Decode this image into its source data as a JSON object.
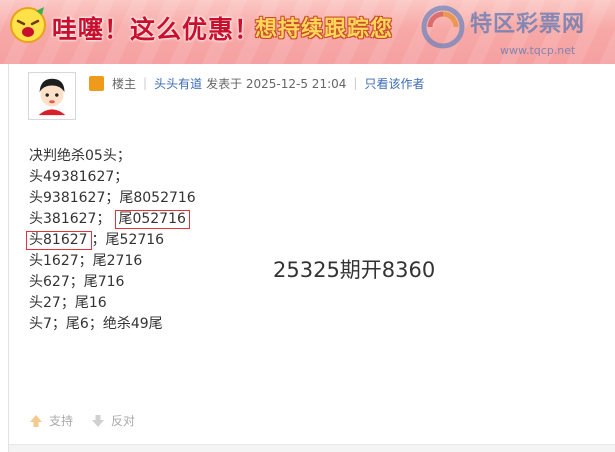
{
  "banner": {
    "slogan": "哇噻！这么优惠！",
    "promo": "想持续跟踪您",
    "watermark_text": "特区彩票网",
    "watermark_url": "www.tqcp.net"
  },
  "post": {
    "meta": {
      "role": "楼主",
      "author": "头头有道",
      "posted": "发表于 2025-12-5 21:04",
      "only_author": "只看该作者"
    },
    "lines": [
      {
        "text": "决判绝杀05头；"
      },
      {
        "text": "头49381627；"
      },
      {
        "text": "头9381627；尾8052716"
      },
      {
        "pre": "头381627；",
        "boxed": "尾052716"
      },
      {
        "boxed": "头81627",
        "post": "；尾52716"
      },
      {
        "text": "头1627；尾2716"
      },
      {
        "text": "头627；尾716"
      },
      {
        "text": "头27；尾16"
      },
      {
        "text": "头7；尾6；绝杀49尾"
      }
    ],
    "result": "25325期开8360",
    "actions": {
      "support": "支持",
      "oppose": "反对"
    }
  },
  "colors": {
    "highlight_border": "#e0343a",
    "link": "#3b6bb3",
    "badge": "#f09a1c"
  }
}
